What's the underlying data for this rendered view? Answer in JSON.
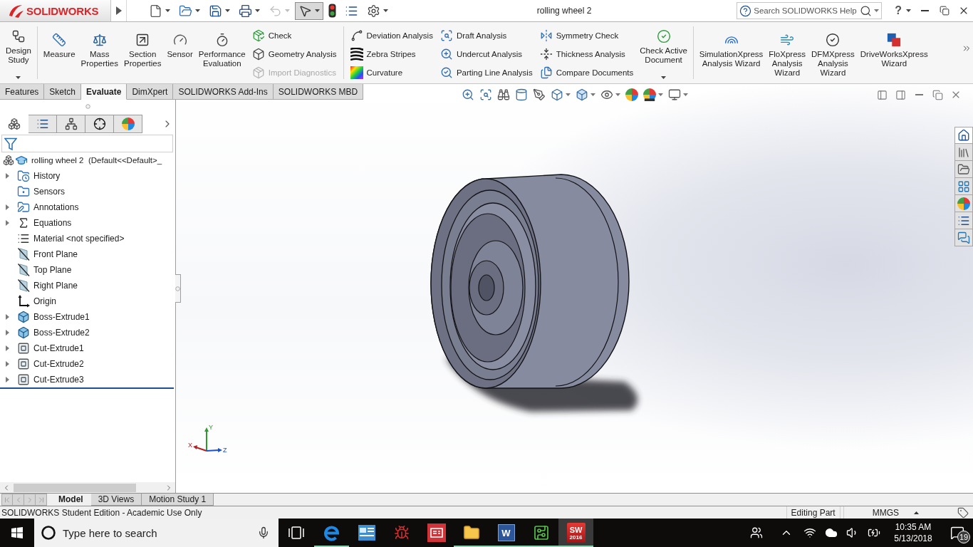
{
  "title_bar": {
    "logo": "SOLIDWORKS",
    "title": "rolling wheel 2",
    "search": {
      "placeholder": "Search SOLIDWORKS Help"
    },
    "help": "?"
  },
  "quick_access": [
    {
      "dropdown": true,
      "pressed": false,
      "disabled": false
    },
    {
      "dropdown": true,
      "pressed": false,
      "disabled": false
    },
    {
      "dropdown": true,
      "pressed": false,
      "disabled": false
    },
    {
      "dropdown": true,
      "pressed": false,
      "disabled": false
    },
    {
      "dropdown": true,
      "pressed": false,
      "disabled": true
    },
    {
      "dropdown": true,
      "pressed": true,
      "disabled": false
    },
    {
      "dropdown": false,
      "pressed": false,
      "disabled": false
    },
    {
      "dropdown": false,
      "pressed": false,
      "disabled": false
    },
    {
      "dropdown": true,
      "pressed": false,
      "disabled": false
    }
  ],
  "ribbon": [
    {
      "kind": "large",
      "label": "Design\nStudy",
      "dropdown": true
    },
    {
      "kind": "separator"
    },
    {
      "kind": "large",
      "label": "Measure",
      "dropdown": false
    },
    {
      "kind": "large",
      "label": "Mass\nProperties",
      "dropdown": false
    },
    {
      "kind": "large",
      "label": "Section\nProperties",
      "dropdown": false
    },
    {
      "kind": "large",
      "label": "Sensor",
      "dropdown": false
    },
    {
      "kind": "large",
      "label": "Performance\nEvaluation",
      "dropdown": false
    },
    {
      "kind": "stack",
      "items": [
        {
          "label": "Check",
          "disabled": false
        },
        {
          "label": "Geometry Analysis",
          "disabled": false
        },
        {
          "label": "Import Diagnostics",
          "disabled": true
        }
      ]
    },
    {
      "kind": "separator"
    },
    {
      "kind": "stack",
      "items": [
        {
          "label": "Deviation Analysis",
          "disabled": false
        },
        {
          "label": "Zebra Stripes",
          "disabled": false
        },
        {
          "label": "Curvature",
          "disabled": false
        }
      ]
    },
    {
      "kind": "stack",
      "items": [
        {
          "label": "Draft Analysis",
          "disabled": false
        },
        {
          "label": "Undercut Analysis",
          "disabled": false
        },
        {
          "label": "Parting Line Analysis",
          "disabled": false
        }
      ]
    },
    {
      "kind": "stack",
      "items": [
        {
          "label": "Symmetry Check",
          "disabled": false
        },
        {
          "label": "Thickness Analysis",
          "disabled": false
        },
        {
          "label": "Compare Documents",
          "disabled": false
        }
      ]
    },
    {
      "kind": "large",
      "label": "Check Active\nDocument",
      "dropdown": true
    },
    {
      "kind": "separator"
    },
    {
      "kind": "large",
      "label": "SimulationXpress\nAnalysis Wizard",
      "dropdown": false
    },
    {
      "kind": "large",
      "label": "FloXpress\nAnalysis\nWizard",
      "dropdown": false
    },
    {
      "kind": "large",
      "label": "DFMXpress\nAnalysis\nWizard",
      "dropdown": false
    },
    {
      "kind": "large",
      "label": "DriveWorksXpress\nWizard",
      "dropdown": false
    }
  ],
  "command_tabs": [
    {
      "label": "Features",
      "selected": false
    },
    {
      "label": "Sketch",
      "selected": false
    },
    {
      "label": "Evaluate",
      "selected": true
    },
    {
      "label": "DimXpert",
      "selected": false
    },
    {
      "label": "SOLIDWORKS Add-Ins",
      "selected": false
    },
    {
      "label": "SOLIDWORKS MBD",
      "selected": false
    }
  ],
  "feature_manager": {
    "panel_tabs": [
      {
        "selected": true
      },
      {
        "selected": false
      },
      {
        "selected": false
      },
      {
        "selected": false
      },
      {
        "selected": false
      }
    ],
    "tree": {
      "label": "rolling wheel 2  (Default<<Default>_",
      "children": [
        {
          "label": "History",
          "kind": "history",
          "expandable": true
        },
        {
          "label": "Sensors",
          "kind": "sensors",
          "expandable": false
        },
        {
          "label": "Annotations",
          "kind": "annotations",
          "expandable": true
        },
        {
          "label": "Equations",
          "kind": "equations",
          "expandable": true
        },
        {
          "label": "Material <not specified>",
          "kind": "material",
          "expandable": false
        },
        {
          "label": "Front Plane",
          "kind": "plane",
          "expandable": false
        },
        {
          "label": "Top Plane",
          "kind": "plane",
          "expandable": false
        },
        {
          "label": "Right Plane",
          "kind": "plane",
          "expandable": false
        },
        {
          "label": "Origin",
          "kind": "origin",
          "expandable": false
        },
        {
          "label": "Boss-Extrude1",
          "kind": "boss",
          "expandable": true
        },
        {
          "label": "Boss-Extrude2",
          "kind": "boss",
          "expandable": true
        },
        {
          "label": "Cut-Extrude1",
          "kind": "cut",
          "expandable": true
        },
        {
          "label": "Cut-Extrude2",
          "kind": "cut",
          "expandable": true
        },
        {
          "label": "Cut-Extrude3",
          "kind": "cut",
          "expandable": true
        }
      ]
    }
  },
  "view_toolbar": [
    {
      "dropdown": false
    },
    {
      "dropdown": false
    },
    {
      "dropdown": false
    },
    {
      "dropdown": false
    },
    {
      "dropdown": false
    },
    {
      "dropdown": true
    },
    {
      "dropdown": true
    },
    {
      "dropdown": true
    },
    {
      "dropdown": false
    },
    {
      "dropdown": true
    },
    {
      "dropdown": true
    }
  ],
  "task_pane": [
    {
      "selected": true
    },
    {
      "selected": false
    },
    {
      "selected": false
    },
    {
      "selected": false
    },
    {
      "selected": false
    },
    {
      "selected": false
    },
    {
      "selected": false
    }
  ],
  "triad": {
    "x": "X",
    "y": "Y",
    "z": "Z"
  },
  "bottom_tabs": [
    {
      "label": "Model",
      "selected": true
    },
    {
      "label": "3D Views",
      "selected": false
    },
    {
      "label": "Motion Study 1",
      "selected": false
    }
  ],
  "status_bar": {
    "message": "SOLIDWORKS Student Edition - Academic Use Only",
    "mode": "Editing Part",
    "units": "MMGS"
  },
  "taskbar": {
    "search": {
      "placeholder": "Type here to search"
    },
    "apps": [
      {
        "running": true,
        "active": false
      },
      {
        "running": false,
        "active": false
      },
      {
        "running": false,
        "active": false
      },
      {
        "running": false,
        "active": false
      },
      {
        "running": true,
        "active": false
      },
      {
        "running": true,
        "active": false,
        "letter": "W"
      },
      {
        "running": true,
        "active": false
      },
      {
        "running": true,
        "active": true,
        "letter": "SW",
        "caption": "2016"
      }
    ],
    "clock": {
      "time": "10:35 AM",
      "date": "5/13/2018"
    },
    "notifications": "19"
  }
}
